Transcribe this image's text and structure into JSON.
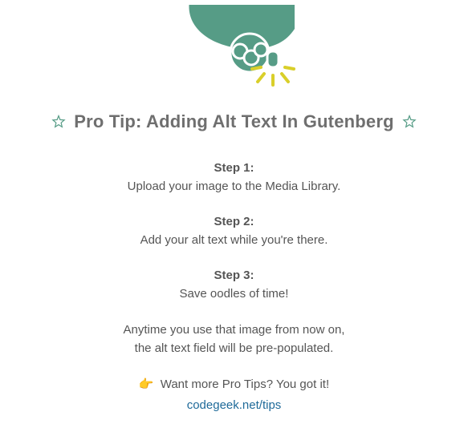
{
  "title": "Pro Tip: Adding Alt Text In Gutenberg",
  "steps": [
    {
      "label": "Step 1:",
      "text": "Upload your image to the Media Library."
    },
    {
      "label": "Step 2:",
      "text": "Add your alt text while you're there."
    },
    {
      "label": "Step 3:",
      "text": "Save oodles of time!"
    }
  ],
  "note_line1": "Anytime you use that image from now on,",
  "note_line2": "the alt text field will be pre-populated.",
  "cta_emoji": "👉",
  "cta_text": "Want more Pro Tips? You got it!",
  "link_text": "codegeek.net/tips",
  "colors": {
    "brand_green": "#569c86",
    "accent_yellow": "#d9cf2a",
    "link": "#1f6a99"
  }
}
